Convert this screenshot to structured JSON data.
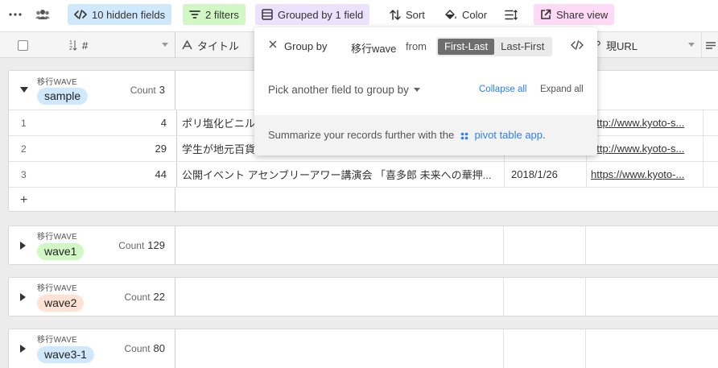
{
  "toolbar": {
    "hidden_fields": "10 hidden fields",
    "filters": "2 filters",
    "grouped": "Grouped by 1 field",
    "sort": "Sort",
    "color": "Color",
    "share": "Share view"
  },
  "header": {
    "col_num": "#",
    "col_title": "タイトル",
    "col_url": "現URL"
  },
  "popover": {
    "group_by_label": "Group by",
    "field_name": "移行wave",
    "from_label": "from",
    "order_options": [
      "First-Last",
      "Last-First"
    ],
    "order_selected": "First-Last",
    "pick_another": "Pick another field to group by",
    "collapse_all": "Collapse all",
    "expand_all": "Expand all",
    "summary_prefix": "Summarize your records further with the",
    "summary_link": "pivot table app",
    "summary_suffix": "."
  },
  "groups": [
    {
      "field_label": "移行WAVE",
      "name": "sample",
      "count_label": "Count",
      "count": "3",
      "chip_color": "#cfe8fc",
      "expanded": true,
      "rows": [
        {
          "index": "1",
          "num": "4",
          "title": "ポリ塩化ビニル",
          "date": "",
          "url": "http://www.kyoto-s..."
        },
        {
          "index": "2",
          "num": "29",
          "title": "学生が地元百貨",
          "date": "",
          "url": "http://www.kyoto-s..."
        },
        {
          "index": "3",
          "num": "44",
          "title": "公開イベント アセンブリーアワー講演会 「喜多郎 未来への華押...",
          "date": "2018/1/26",
          "url": "https://www.kyoto-..."
        }
      ],
      "add_label": "+"
    },
    {
      "field_label": "移行WAVE",
      "name": "wave1",
      "count_label": "Count",
      "count": "129",
      "chip_color": "#d1f7c4",
      "expanded": false
    },
    {
      "field_label": "移行WAVE",
      "name": "wave2",
      "count_label": "Count",
      "count": "22",
      "chip_color": "#fee2d5",
      "expanded": false
    },
    {
      "field_label": "移行WAVE",
      "name": "wave3-1",
      "count_label": "Count",
      "count": "80",
      "chip_color": "#cfe8fc",
      "expanded": false
    }
  ],
  "colors": {
    "accent_link": "#2d7ff9",
    "hidden_bg": "#cfe8fc",
    "filters_bg": "#d1f7c4",
    "grouped_bg": "#ede2fe",
    "share_bg": "#ffdaf6"
  }
}
